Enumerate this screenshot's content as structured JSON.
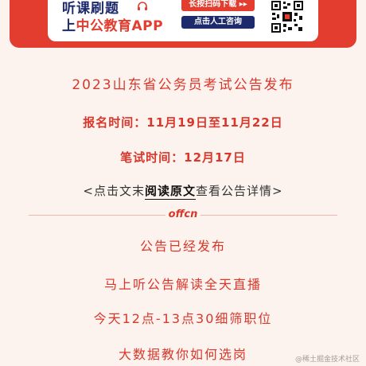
{
  "banner": {
    "line1": "听课刷题",
    "line2_prefix": "上",
    "line2_highlight": "中公教育APP",
    "scan_button": "长按扫码下载 ▸▸",
    "consult_button": "点击人工咨询",
    "colors": {
      "red": "#e23d2f",
      "navy": "#1d2a6b"
    }
  },
  "announcement": {
    "title": "2023山东省公务员考试公告发布",
    "registration_time": "报名时间：11月19日至11月22日",
    "exam_time": "笔试时间：12月17日",
    "read_hint_prefix": "<点击文末",
    "read_hint_emphasis": "阅读原文",
    "read_hint_suffix": "查看公告详情>"
  },
  "divider": {
    "logo": "offcn"
  },
  "items": [
    "公告已经发布",
    "马上听公告解读全天直播",
    "今天12点-13点30细筛职位",
    "大数据教你如何选岗"
  ],
  "watermark": "@稀土掘金技术社区"
}
